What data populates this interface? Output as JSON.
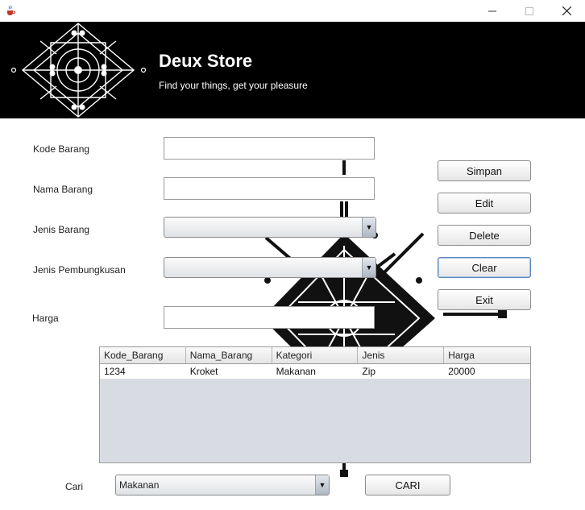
{
  "window": {
    "app_icon": "java-cup-icon",
    "controls": [
      "minimize-icon",
      "maximize-icon",
      "close-icon"
    ]
  },
  "header": {
    "logo": "ornamental-diamond-logo",
    "title": "Deux Store",
    "subtitle": "Find your things, get your pleasure"
  },
  "form": {
    "kode_label": "Kode Barang",
    "kode_value": "",
    "nama_label": "Nama Barang",
    "nama_value": "",
    "jenis_label": "Jenis Barang",
    "jenis_value": "",
    "pembungkusan_label": "Jenis Pembungkusan",
    "pembungkusan_value": "",
    "harga_label": "Harga",
    "harga_value": ""
  },
  "buttons": {
    "simpan": "Simpan",
    "edit": "Edit",
    "delete": "Delete",
    "clear": "Clear",
    "exit": "Exit"
  },
  "table": {
    "columns": [
      "Kode_Barang",
      "Nama_Barang",
      "Kategori",
      "Jenis",
      "Harga"
    ],
    "rows": [
      [
        "1234",
        "Kroket",
        "Makanan",
        "Zip",
        "20000"
      ]
    ]
  },
  "search": {
    "label": "Cari",
    "value": "Makanan",
    "button": "CARI"
  },
  "colors": {
    "banner": "#000000",
    "focus_border": "#5a87bd",
    "table_bg": "#d8dce2"
  }
}
